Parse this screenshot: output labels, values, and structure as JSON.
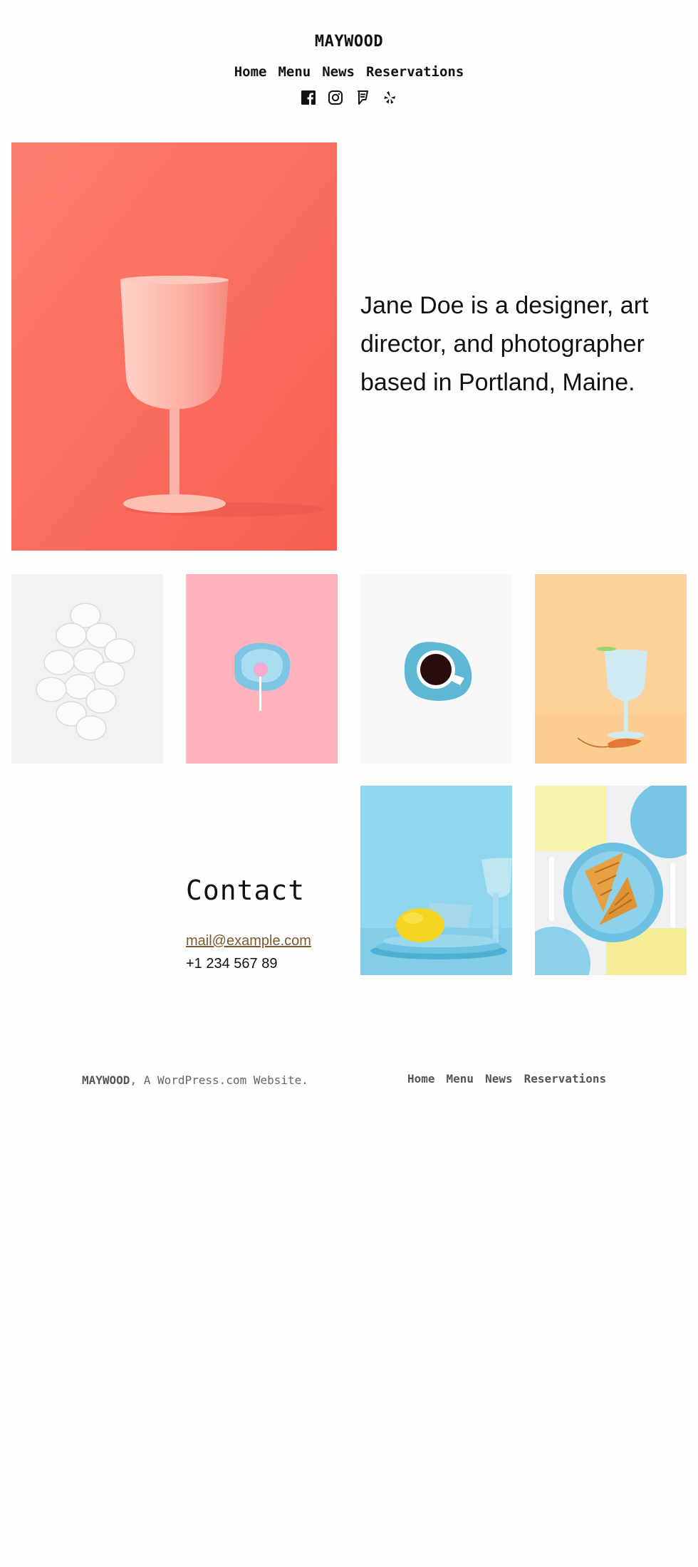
{
  "site": {
    "title": "MAYWOOD"
  },
  "nav": {
    "items": [
      "Home",
      "Menu",
      "News",
      "Reservations"
    ]
  },
  "social": {
    "icons": [
      "facebook-icon",
      "instagram-icon",
      "foursquare-icon",
      "yelp-icon"
    ]
  },
  "hero": {
    "bio": "Jane Doe is a designer, art director, and photographer based in Portland, Maine."
  },
  "gallery": {
    "images": [
      "wine-glass-photo",
      "eggs-photo",
      "lollipop-photo",
      "coffee-cup-photo",
      "glass-shrimp-photo",
      "lemon-plates-photo",
      "waffles-photo"
    ]
  },
  "contact": {
    "heading": "Contact",
    "email": "mail@example.com",
    "phone": "+1 234 567 89"
  },
  "footer": {
    "brand": "MAYWOOD",
    "tagline": ", A WordPress.com Website.",
    "nav": [
      "Home",
      "Menu",
      "News",
      "Reservations"
    ]
  },
  "colors": {
    "coral": "#fb7060",
    "pink": "#ffb3bc",
    "sky": "#8fd6ee",
    "peach": "#fdd19a",
    "link": "#7a5a2e"
  }
}
